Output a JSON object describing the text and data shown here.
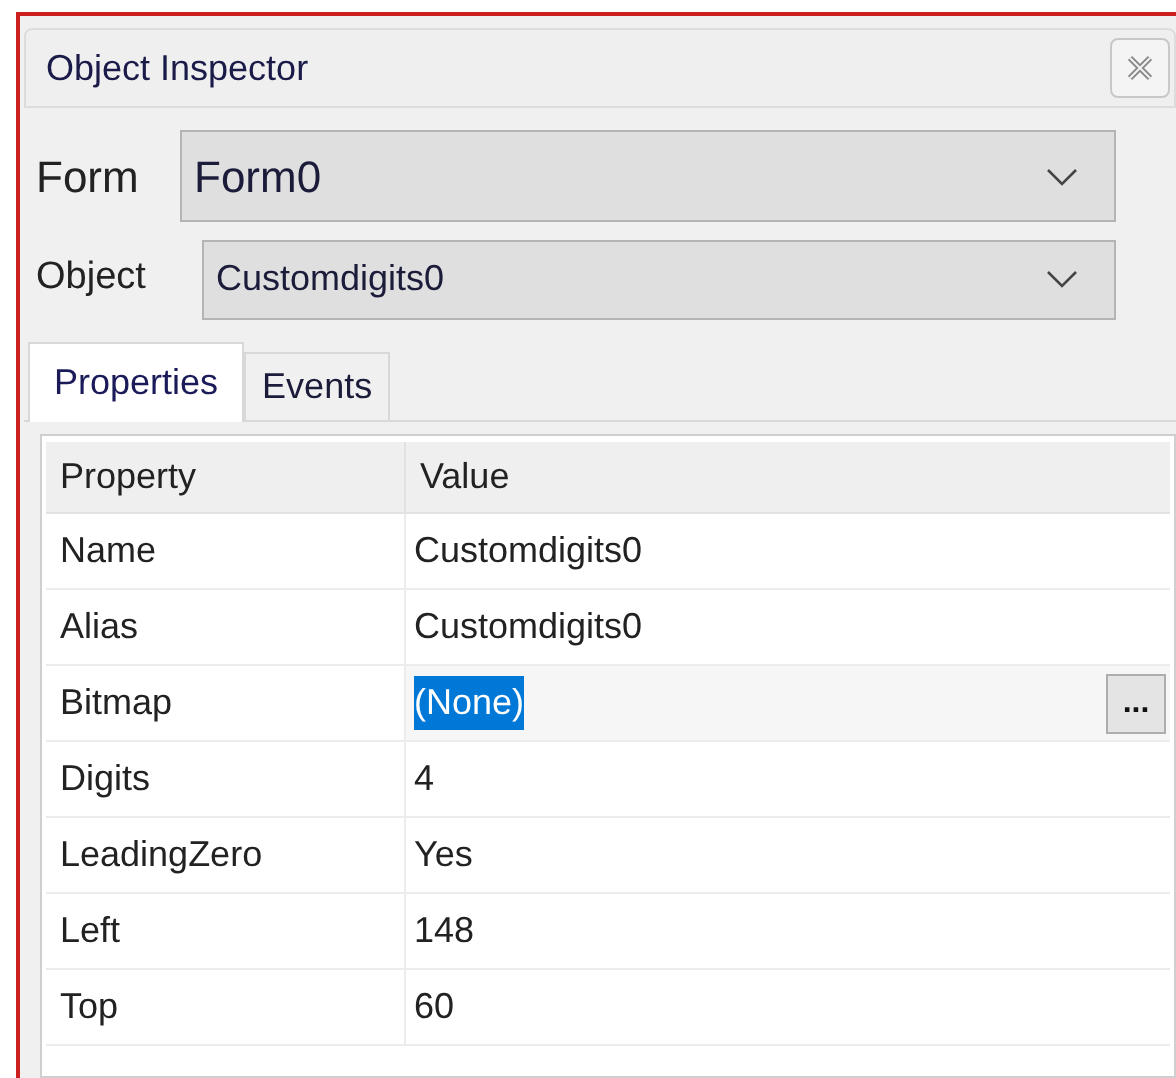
{
  "window": {
    "title": "Object Inspector"
  },
  "form_selector": {
    "label": "Form",
    "value": "Form0"
  },
  "object_selector": {
    "label": "Object",
    "value": "Customdigits0"
  },
  "tabs": [
    {
      "label": "Properties",
      "selected": true
    },
    {
      "label": "Events",
      "selected": false
    }
  ],
  "grid": {
    "columns": [
      "Property",
      "Value"
    ],
    "edit_button": "...",
    "rows": [
      {
        "property": "Name",
        "value": "Customdigits0",
        "selected": false
      },
      {
        "property": "Alias",
        "value": "Customdigits0",
        "selected": false
      },
      {
        "property": "Bitmap",
        "value": "(None)",
        "selected": true
      },
      {
        "property": "Digits",
        "value": "4",
        "selected": false
      },
      {
        "property": "LeadingZero",
        "value": "Yes",
        "selected": false
      },
      {
        "property": "Left",
        "value": "148",
        "selected": false
      },
      {
        "property": "Top",
        "value": "60",
        "selected": false
      }
    ]
  }
}
